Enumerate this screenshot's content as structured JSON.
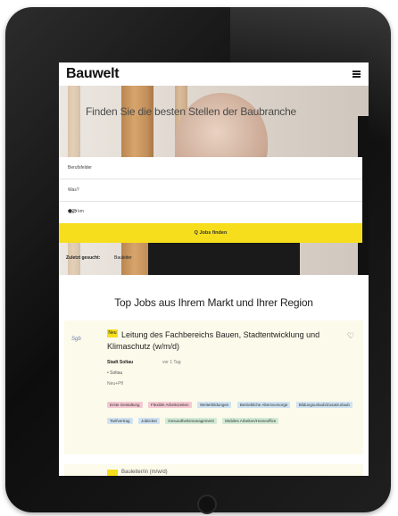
{
  "header": {
    "logo": "Bauwelt"
  },
  "hero": {
    "headline": "Finden Sie die besten Stellen der Baubranche"
  },
  "search": {
    "fields": [
      {
        "label": "Berufsfelder"
      },
      {
        "label": "Was?"
      },
      {
        "label": "Wo?",
        "radius": "+ 25 km"
      }
    ],
    "button_label": "Q Jobs finden",
    "last_search_label": "Zuletzt gesucht:",
    "last_search_value": "Bauleiter"
  },
  "section": {
    "title": "Top Jobs aus Ihrem Markt und Ihrer Region"
  },
  "job_card": {
    "badge": "Neu",
    "company_logo_text": "Sgb",
    "title": "Leitung des Fachbereichs Bauen, Stadtentwicklung und Klimaschutz (w/m/d)",
    "employer": "Stadt Soltau",
    "posted": "vor 1 Tag",
    "meta_line1": "• Soltau",
    "meta_line2": "Neu+Pfl",
    "tags": [
      {
        "label": "Erste Gestaltung",
        "color": "pink"
      },
      {
        "label": "Flexible Arbeitszeiten",
        "color": "pink"
      },
      {
        "label": "Weiterbildungen",
        "color": "blue"
      },
      {
        "label": "Betriebliche Altersvorsorge",
        "color": "blue"
      },
      {
        "label": "Bildungsurlaub/Zusatzurlaub",
        "color": "blue"
      },
      {
        "label": "Tarifvertrag",
        "color": "blue"
      },
      {
        "label": "Jobticket",
        "color": "blue"
      },
      {
        "label": "Gesundheitsmanagement",
        "color": "green"
      },
      {
        "label": "Mobiles Arbeiten/Homeoffice",
        "color": "green"
      }
    ]
  },
  "job_card2": {
    "title": "Bauleiter/in (m/w/d)"
  }
}
